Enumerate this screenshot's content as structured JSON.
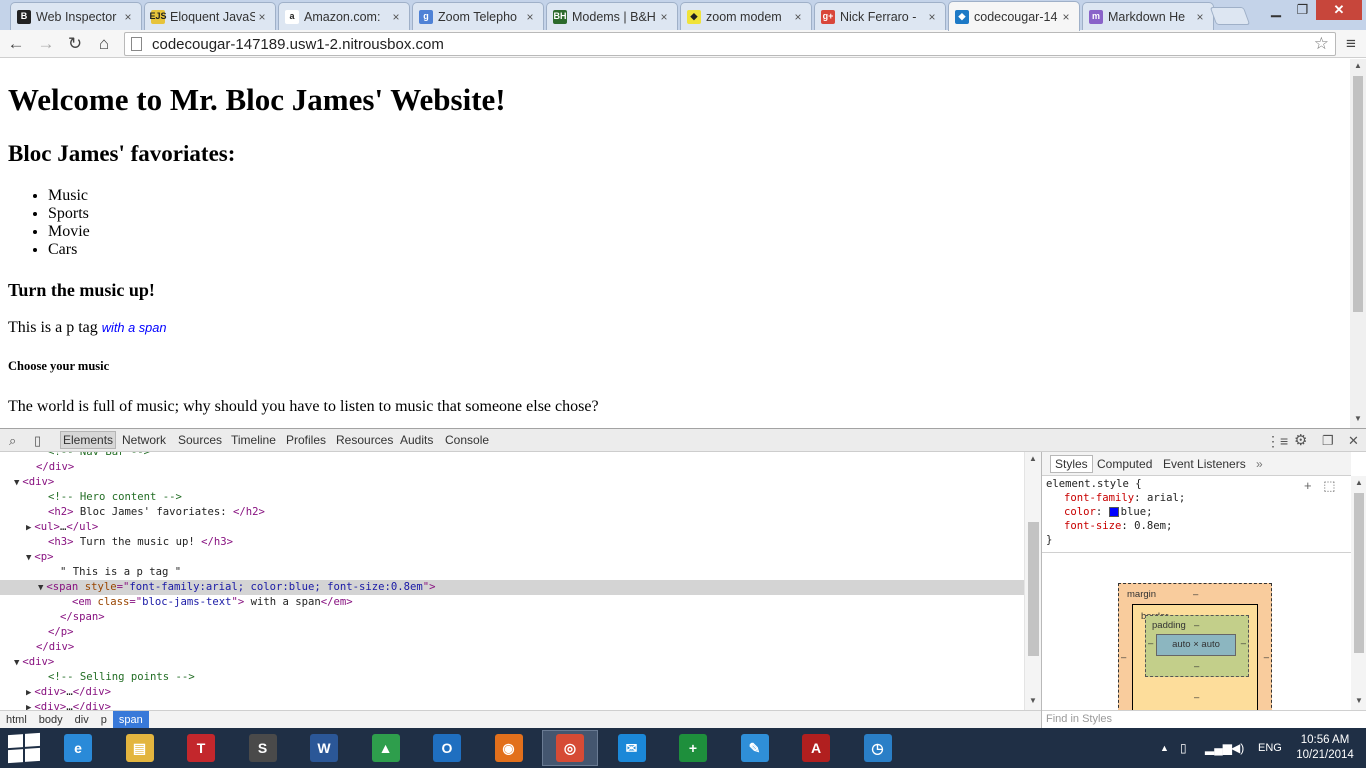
{
  "window": {
    "tabs": [
      {
        "title": "Web Inspector",
        "icon": "B",
        "icon_color": "#222222",
        "active": false
      },
      {
        "title": "Eloquent JavaS",
        "icon": "EJS",
        "icon_color": "#e7c33b",
        "active": false
      },
      {
        "title": "Amazon.com:",
        "icon": "a",
        "icon_color": "#ffffff",
        "active": false
      },
      {
        "title": "Zoom Telepho",
        "icon": "g",
        "icon_color": "#4f82d6",
        "active": false
      },
      {
        "title": "Modems | B&H",
        "icon": "BH",
        "icon_color": "#2d6b2d",
        "active": false
      },
      {
        "title": "zoom modem",
        "icon": "tag",
        "icon_color": "#f0e33a",
        "active": false
      },
      {
        "title": "Nick Ferraro -",
        "icon": "g+",
        "icon_color": "#d9463a",
        "active": false
      },
      {
        "title": "codecougar-14",
        "icon": "nitrous",
        "icon_color": "#1e7ac6",
        "active": true
      },
      {
        "title": "Markdown He",
        "icon": "m",
        "icon_color": "#8a63c9",
        "active": false
      }
    ],
    "minimize": "▁",
    "maximize": "❐",
    "close": "✕"
  },
  "toolbar": {
    "back": "←",
    "forward": "→",
    "reload": "↻",
    "home": "⌂",
    "url": "codecougar-147189.usw1-2.nitrousbox.com",
    "star": "☆",
    "menu": "≡"
  },
  "page": {
    "h1": "Welcome to Mr. Bloc James' Website!",
    "h2": "Bloc James' favoriates:",
    "list": [
      "Music",
      "Sports",
      "Movie",
      "Cars"
    ],
    "h3": "Turn the music up!",
    "p_text": "This is a p tag ",
    "p_span": "with a span",
    "h5": "Choose your music",
    "world": "The world is full of music; why should you have to listen to music that someone else chose?"
  },
  "devtools": {
    "tabs": [
      "Elements",
      "Network",
      "Sources",
      "Timeline",
      "Profiles",
      "Resources",
      "Audits",
      "Console"
    ],
    "selected_tab": "Elements",
    "dom_lines": [
      {
        "indent": 4,
        "tri": "",
        "parts": [
          [
            "cmt",
            "<!-- Nav Bar -->"
          ]
        ]
      },
      {
        "indent": 3,
        "tri": "",
        "parts": [
          [
            "tag",
            "</div>"
          ]
        ]
      },
      {
        "indent": 2,
        "tri": "▼",
        "parts": [
          [
            "tag",
            "<div>"
          ]
        ]
      },
      {
        "indent": 4,
        "tri": "",
        "parts": [
          [
            "cmt",
            "<!-- Hero content -->"
          ]
        ]
      },
      {
        "indent": 4,
        "tri": "",
        "parts": [
          [
            "tag",
            "<h2>"
          ],
          [
            "txt",
            " Bloc James' favoriates: "
          ],
          [
            "tag",
            "</h2>"
          ]
        ]
      },
      {
        "indent": 3,
        "tri": "▶",
        "parts": [
          [
            "tag",
            "<ul>"
          ],
          [
            "txt",
            "…"
          ],
          [
            "tag",
            "</ul>"
          ]
        ]
      },
      {
        "indent": 4,
        "tri": "",
        "parts": [
          [
            "tag",
            "<h3>"
          ],
          [
            "txt",
            " Turn the music up! "
          ],
          [
            "tag",
            "</h3>"
          ]
        ]
      },
      {
        "indent": 3,
        "tri": "▼",
        "parts": [
          [
            "tag",
            "<p>"
          ]
        ]
      },
      {
        "indent": 5,
        "tri": "",
        "parts": [
          [
            "txt",
            "\" This is a p tag \""
          ]
        ]
      },
      {
        "indent": 4,
        "tri": "▼",
        "sel": true,
        "parts": [
          [
            "tag",
            "<span "
          ],
          [
            "attrn",
            "style"
          ],
          [
            "tag",
            "=\""
          ],
          [
            "attrv",
            "font-family:arial; color:blue; font-size:0.8em"
          ],
          [
            "tag",
            "\">"
          ]
        ]
      },
      {
        "indent": 6,
        "tri": "",
        "parts": [
          [
            "tag",
            "<em "
          ],
          [
            "attrn",
            "class"
          ],
          [
            "tag",
            "=\""
          ],
          [
            "attrv",
            "bloc-jams-text"
          ],
          [
            "tag",
            "\">"
          ],
          [
            "txt",
            " with a span"
          ],
          [
            "tag",
            "</em>"
          ]
        ]
      },
      {
        "indent": 5,
        "tri": "",
        "parts": [
          [
            "tag",
            "</span>"
          ]
        ]
      },
      {
        "indent": 4,
        "tri": "",
        "parts": [
          [
            "tag",
            "</p>"
          ]
        ]
      },
      {
        "indent": 3,
        "tri": "",
        "parts": [
          [
            "tag",
            "</div>"
          ]
        ]
      },
      {
        "indent": 2,
        "tri": "▼",
        "parts": [
          [
            "tag",
            "<div>"
          ]
        ]
      },
      {
        "indent": 4,
        "tri": "",
        "parts": [
          [
            "cmt",
            "<!-- Selling points -->"
          ]
        ]
      },
      {
        "indent": 3,
        "tri": "▶",
        "parts": [
          [
            "tag",
            "<div>"
          ],
          [
            "txt",
            "…"
          ],
          [
            "tag",
            "</div>"
          ]
        ]
      },
      {
        "indent": 3,
        "tri": "▶",
        "parts": [
          [
            "tag",
            "<div>"
          ],
          [
            "txt",
            "…"
          ],
          [
            "tag",
            "</div>"
          ]
        ]
      }
    ],
    "breadcrumbs": [
      "html",
      "body",
      "div",
      "p",
      "span"
    ],
    "styles_tabs": [
      "Styles",
      "Computed",
      "Event Listeners"
    ],
    "styles_more": "»",
    "rule_selector": "element.style {",
    "rule_props": [
      {
        "name": "font-family",
        "value": "arial;"
      },
      {
        "name": "color",
        "value": "blue;",
        "swatch": "#0000ff"
      },
      {
        "name": "font-size",
        "value": "0.8em;"
      }
    ],
    "rule_close": "}",
    "boxmodel": {
      "margin": "margin",
      "border": "border",
      "padding": "padding",
      "content": "auto × auto",
      "dash": "–"
    },
    "find_placeholder": "Find in Styles"
  },
  "taskbar": {
    "apps": [
      {
        "name": "ie",
        "glyph": "e",
        "color": "#2a8ad8"
      },
      {
        "name": "explorer",
        "glyph": "▤",
        "color": "#e3b53f"
      },
      {
        "name": "t-app",
        "glyph": "T",
        "color": "#c3272c"
      },
      {
        "name": "sublime",
        "glyph": "S",
        "color": "#4a4a4a"
      },
      {
        "name": "word",
        "glyph": "W",
        "color": "#2b5797"
      },
      {
        "name": "drive",
        "glyph": "▲",
        "color": "#2e9e4c"
      },
      {
        "name": "outlook",
        "glyph": "O",
        "color": "#1f6fc0"
      },
      {
        "name": "firefox",
        "glyph": "◉",
        "color": "#e2701c"
      },
      {
        "name": "chrome",
        "glyph": "◎",
        "color": "#d64b35"
      },
      {
        "name": "lync",
        "glyph": "✉",
        "color": "#1b88d8"
      },
      {
        "name": "excel",
        "glyph": "+",
        "color": "#1e8f3c"
      },
      {
        "name": "notes",
        "glyph": "✎",
        "color": "#2f8fd8"
      },
      {
        "name": "acrobat",
        "glyph": "A",
        "color": "#b11f1f"
      },
      {
        "name": "safari",
        "glyph": "◷",
        "color": "#2a7fc7"
      }
    ],
    "language": "ENG",
    "time": "10:56 AM",
    "date": "10/21/2014"
  }
}
